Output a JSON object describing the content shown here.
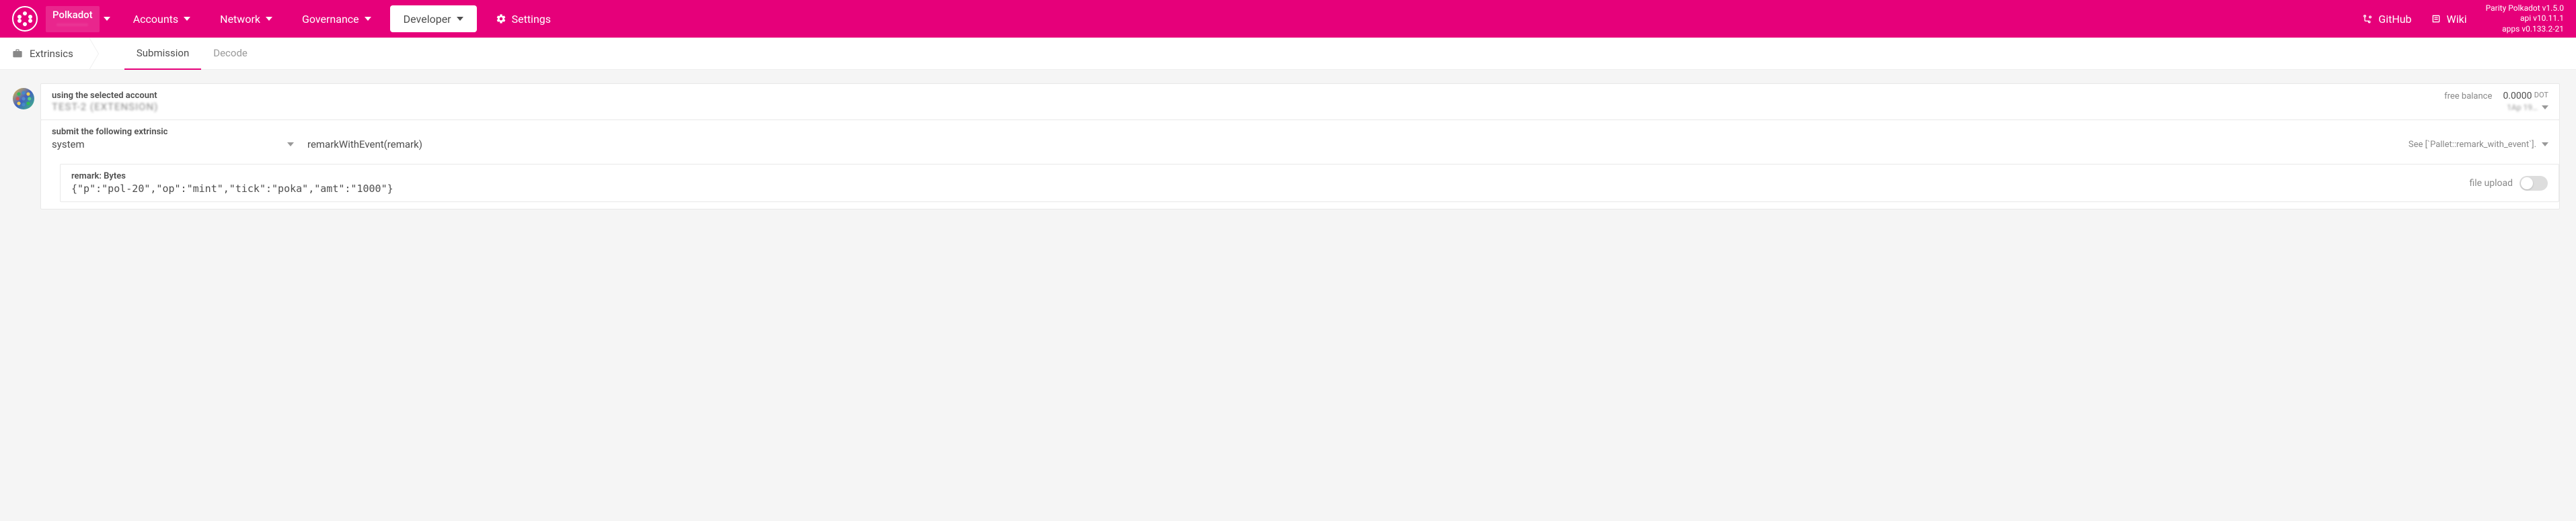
{
  "chain": {
    "name": "Polkadot",
    "addr": "············"
  },
  "nav": {
    "accounts": "Accounts",
    "network": "Network",
    "governance": "Governance",
    "developer": "Developer",
    "settings": "Settings"
  },
  "links": {
    "github": "GitHub",
    "wiki": "Wiki"
  },
  "version": {
    "line1": "Parity Polkadot v1.5.0",
    "line2": "api v10.11.1",
    "line3": "apps v0.133.2-21"
  },
  "subnav": {
    "crumb": "Extrinsics",
    "tabs": {
      "submission": "Submission",
      "decode": "Decode"
    }
  },
  "account": {
    "label": "using the selected account",
    "name": "TEST-2 (EXTENSION)",
    "balance_label": "free balance",
    "balance_value": "0.0000",
    "balance_unit": "DOT",
    "addr_short": "1Ap 19…"
  },
  "extrinsic": {
    "label": "submit the following extrinsic",
    "pallet": "system",
    "call": "remarkWithEvent(remark)",
    "hint": "See [`Pallet::remark_with_event`]."
  },
  "param": {
    "label": "remark: Bytes",
    "value": "{\"p\":\"pol-20\",\"op\":\"mint\",\"tick\":\"poka\",\"amt\":\"1000\"}",
    "upload_label": "file upload"
  }
}
